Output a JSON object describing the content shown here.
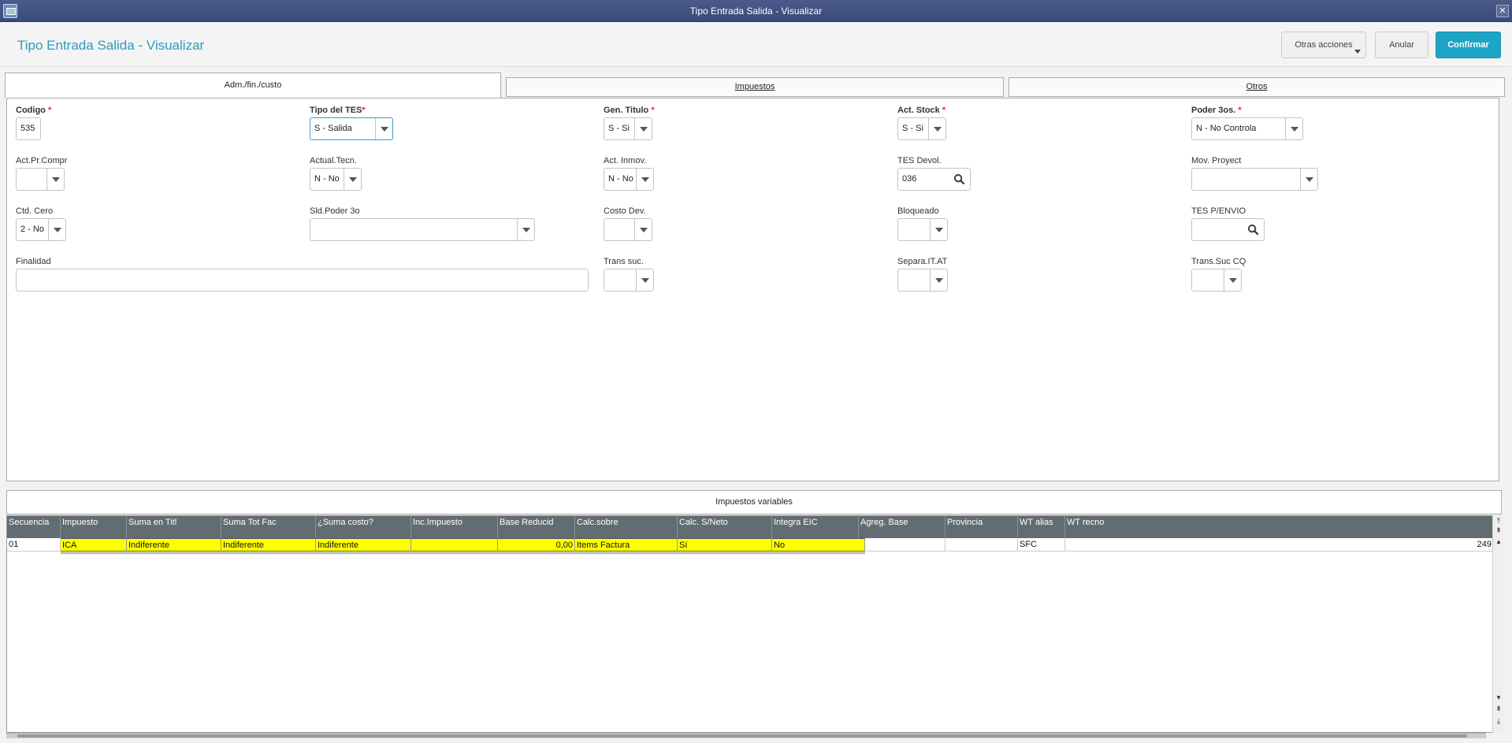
{
  "window": {
    "title": "Tipo Entrada Salida - Visualizar",
    "close_glyph": "✕"
  },
  "header": {
    "title": "Tipo Entrada Salida - Visualizar",
    "buttons": {
      "otras": "Otras acciones",
      "anular": "Anular",
      "confirmar": "Confirmar"
    }
  },
  "tabs": [
    {
      "label": "Adm./fin./custo",
      "active": true
    },
    {
      "label": "Impuestos",
      "active": false
    },
    {
      "label": "Otros",
      "active": false
    }
  ],
  "form": {
    "codigo": {
      "label": "Codigo",
      "value": "535"
    },
    "tipo_tes": {
      "label": "Tipo del TES",
      "value": "S - Salida"
    },
    "gen_titulo": {
      "label": "Gen. Titulo",
      "value": "S - Si"
    },
    "act_stock": {
      "label": "Act. Stock",
      "value": "S - Si"
    },
    "poder_3os": {
      "label": "Poder 3os.",
      "value": "N - No Controla"
    },
    "act_pr_compr": {
      "label": "Act.Pr.Compr",
      "value": ""
    },
    "actual_tecn": {
      "label": "Actual.Tecn.",
      "value": "N - No"
    },
    "act_inmov": {
      "label": "Act. Inmov.",
      "value": "N - No"
    },
    "tes_devol": {
      "label": "TES Devol.",
      "value": "036"
    },
    "mov_proyect": {
      "label": "Mov. Proyect",
      "value": ""
    },
    "ctd_cero": {
      "label": "Ctd. Cero",
      "value": "2 - No"
    },
    "sld_poder_3o": {
      "label": "Sld.Poder 3o",
      "value": ""
    },
    "costo_dev": {
      "label": "Costo Dev.",
      "value": ""
    },
    "bloqueado": {
      "label": "Bloqueado",
      "value": ""
    },
    "tes_penvio": {
      "label": "TES P/ENVIO",
      "value": ""
    },
    "finalidad": {
      "label": "Finalidad",
      "value": ""
    },
    "trans_suc": {
      "label": "Trans suc.",
      "value": ""
    },
    "separa_it_at": {
      "label": "Separa.IT.AT",
      "value": ""
    },
    "trans_suc_cq": {
      "label": "Trans.Suc CQ",
      "value": ""
    }
  },
  "impuestos": {
    "title": "Impuestos variables",
    "columns": [
      "Secuencia",
      "Impuesto",
      "Suma en Titl",
      "Suma Tot Fac",
      "¿Suma costo?",
      "Inc.Impuesto",
      "Base Reducid",
      "Calc.sobre",
      "Calc. S/Neto",
      "Integra EIC",
      "Agreg. Base",
      "Provincia",
      "WT alias",
      "WT recno"
    ],
    "row": [
      "01",
      "ICA",
      "Indiferente",
      "Indiferente",
      "Indiferente",
      "",
      "0,00",
      "Items Factura",
      "Sí",
      "No",
      "",
      "",
      "SFC",
      "249"
    ]
  },
  "colors": {
    "accent": "#1ea5c6",
    "title": "#2a9cbc",
    "highlight": "#ffff00",
    "grid_header": "#616d72",
    "required": "#e03030"
  }
}
